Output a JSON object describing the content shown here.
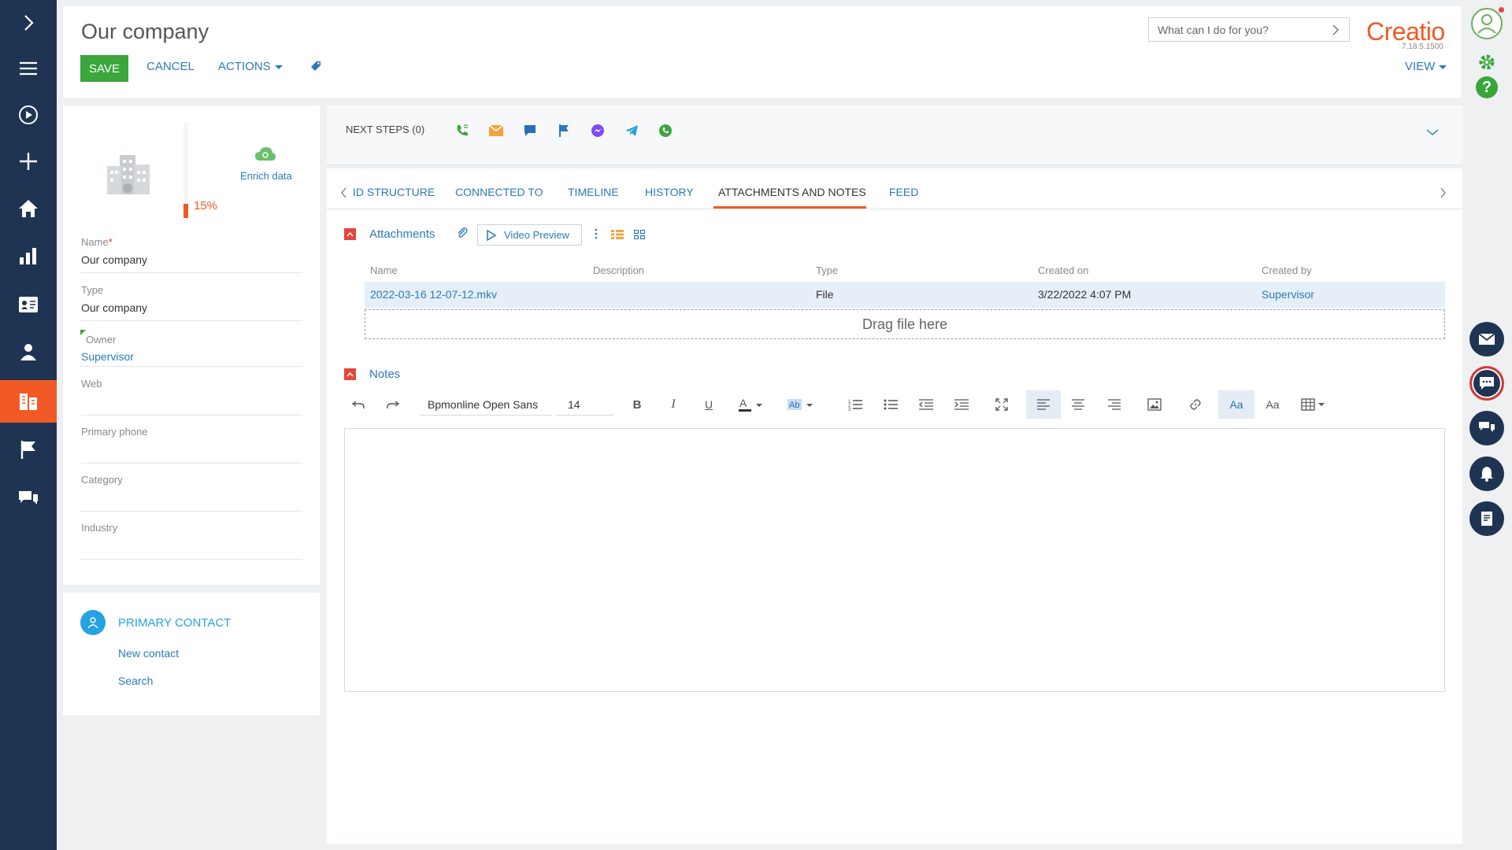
{
  "header": {
    "title": "Our company",
    "save": "SAVE",
    "cancel": "CANCEL",
    "actions": "ACTIONS",
    "search_placeholder": "What can I do for you?",
    "logo": "Creatio",
    "version": "7.18.5.1500",
    "view": "VIEW"
  },
  "profile": {
    "completeness": "15%",
    "completeness_value": 0.15,
    "enrich": "Enrich data",
    "fields": [
      {
        "label": "Name",
        "value": "Our company",
        "required": "*"
      },
      {
        "label": "Type",
        "value": "Our company"
      },
      {
        "label": "Owner",
        "value": "Supervisor"
      },
      {
        "label": "Web",
        "value": ""
      },
      {
        "label": "Primary phone",
        "value": ""
      },
      {
        "label": "Category",
        "value": ""
      },
      {
        "label": "Industry",
        "value": ""
      }
    ]
  },
  "contact": {
    "title": "PRIMARY CONTACT",
    "new_contact": "New contact",
    "search": "Search"
  },
  "next_steps": {
    "label": "NEXT STEPS (0)"
  },
  "tabs": [
    "ID STRUCTURE",
    "CONNECTED TO",
    "TIMELINE",
    "HISTORY",
    "ATTACHMENTS AND NOTES",
    "FEED"
  ],
  "attachments": {
    "title": "Attachments",
    "video_preview": "Video Preview",
    "columns": [
      "Name",
      "Description",
      "Type",
      "Created on",
      "Created by"
    ],
    "rows": [
      {
        "name": "2022-03-16 12-07-12.mkv",
        "description": "",
        "type": "File",
        "created_on": "3/22/2022 4:07 PM",
        "created_by": "Supervisor"
      }
    ],
    "drop_text": "Drag file here"
  },
  "notes": {
    "title": "Notes",
    "font": "Bpmonline Open Sans",
    "size": "14"
  },
  "colors": {
    "nav_bg": "#1f3453",
    "accent": "#f15a24",
    "link": "#2a7ab8",
    "save": "#3aa63c"
  }
}
